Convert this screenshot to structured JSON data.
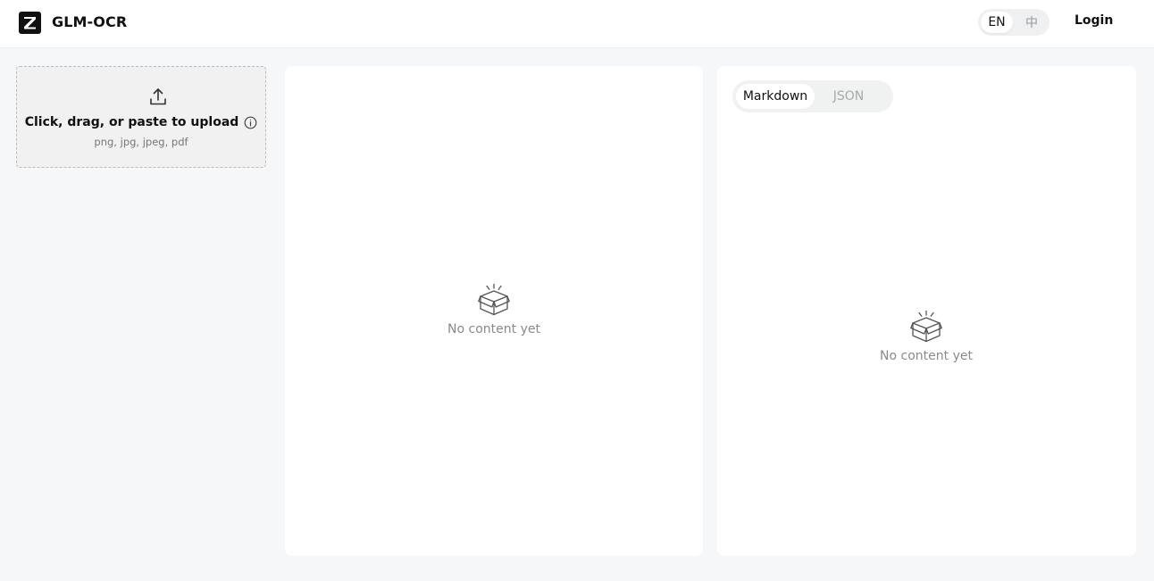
{
  "header": {
    "brand": "GLM-OCR",
    "lang_en": "EN",
    "lang_zh": "中",
    "login": "Login"
  },
  "upload": {
    "title": "Click, drag, or paste to upload",
    "formats": "png, jpg, jpeg, pdf"
  },
  "preview": {
    "empty_text": "No content yet"
  },
  "result": {
    "tabs": [
      "Markdown",
      "JSON"
    ],
    "active_tab": "Markdown",
    "empty_text": "No content yet"
  },
  "icons": {
    "logo": "z-logo-icon",
    "upload": "upload-icon",
    "info": "info-icon",
    "empty": "empty-box-icon"
  }
}
